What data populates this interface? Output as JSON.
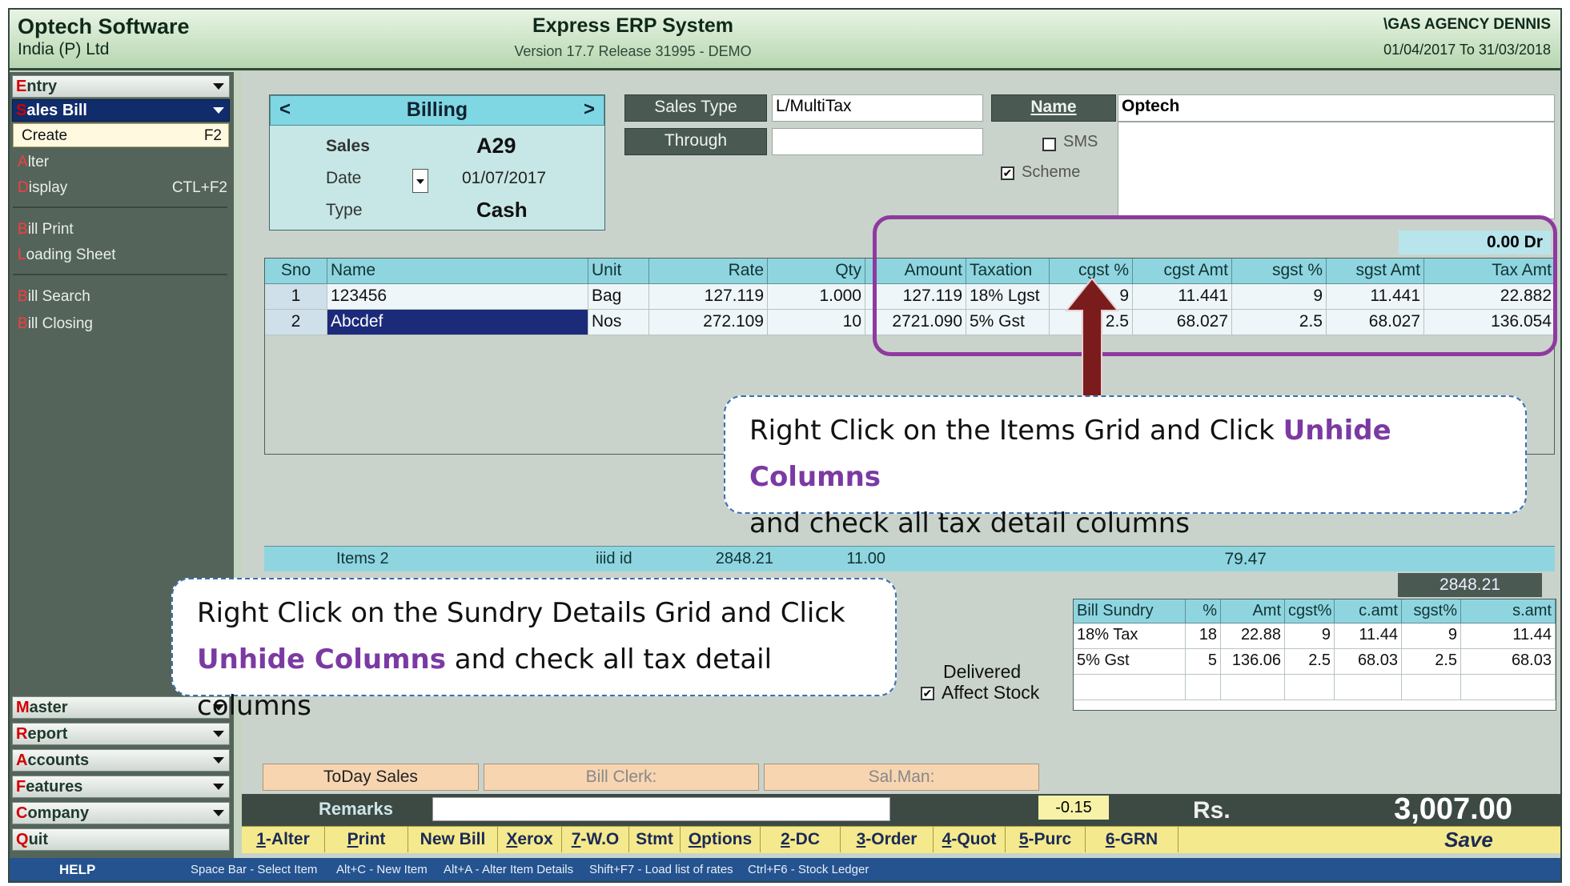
{
  "header": {
    "company_line1": "Optech Software",
    "company_line2": "India (P) Ltd",
    "app_title": "Express ERP System",
    "version": "Version 17.7 Release 31995 - DEMO",
    "agency": "\\GAS AGENCY DENNIS",
    "period": "01/04/2017 To 31/03/2018"
  },
  "sidebar": {
    "entry": {
      "first": "E",
      "rest": "ntry"
    },
    "sales_bill": {
      "first": "S",
      "rest": "ales Bill"
    },
    "create": {
      "first": "C",
      "rest": "reate",
      "shortcut": "F2"
    },
    "alter": {
      "first": "A",
      "rest": "lter"
    },
    "display": {
      "first": "D",
      "rest": "isplay",
      "shortcut": "CTL+F2"
    },
    "bill_print": {
      "first": "B",
      "rest": "ill Print"
    },
    "loading_sheet": {
      "first": "L",
      "rest": "oading Sheet"
    },
    "bill_search": {
      "first": "B",
      "rest": "ill Search"
    },
    "bill_closing": {
      "first": "B",
      "rest": "ill Closing"
    },
    "master": {
      "first": "M",
      "rest": "aster"
    },
    "report": {
      "first": "R",
      "rest": "eport"
    },
    "accounts": {
      "first": "A",
      "rest": "ccounts"
    },
    "features": {
      "first": "F",
      "rest": "eatures"
    },
    "company": {
      "first": "C",
      "rest": "ompany"
    },
    "quit": {
      "first": "Q",
      "rest": "uit"
    }
  },
  "billing": {
    "prev": "<",
    "title": "Billing",
    "next": ">",
    "sales_label": "Sales",
    "sales_value": "A29",
    "date_label": "Date",
    "date_value": "01/07/2017",
    "type_label": "Type",
    "type_value": "Cash"
  },
  "form": {
    "sales_type_label": "Sales Type",
    "sales_type_value": "L/MultiTax",
    "through_label": "Through",
    "through_value": "",
    "name_label": "Name",
    "name_value": "Optech",
    "sms_label": "SMS",
    "sms_checked": false,
    "scheme_label": "Scheme",
    "scheme_checked": true,
    "balance": "0.00 Dr"
  },
  "items_grid": {
    "headers": [
      "Sno",
      "Name",
      "Unit",
      "Rate",
      "Qty",
      "Amount",
      "Taxation",
      "cgst %",
      "cgst Amt",
      "sgst %",
      "sgst Amt",
      "Tax Amt"
    ],
    "rows": [
      [
        "1",
        "123456",
        "Bag",
        "127.119",
        "1.000",
        "127.119",
        "18% Lgst",
        "9",
        "11.441",
        "9",
        "11.441",
        "22.882"
      ],
      [
        "2",
        "Abcdef",
        "Nos",
        "272.109",
        "10",
        "2721.090",
        "5% Gst",
        "2.5",
        "68.027",
        "2.5",
        "68.027",
        "136.054"
      ]
    ],
    "footer": {
      "items": "Items 2",
      "unit": "iiid id",
      "rate": "2848.21",
      "qty": "11.00",
      "cgst_amt": "79.47"
    }
  },
  "sundry": {
    "subtotal": "2848.21",
    "headers": [
      "Bill Sundry",
      "%",
      "Amt",
      "cgst%",
      "c.amt",
      "sgst%",
      "s.amt"
    ],
    "rows": [
      [
        "18% Tax",
        "18",
        "22.88",
        "9",
        "11.44",
        "9",
        "11.44"
      ],
      [
        "5% Gst",
        "5",
        "136.06",
        "2.5",
        "68.03",
        "2.5",
        "68.03"
      ]
    ]
  },
  "options": {
    "delivered_label": "Delivered",
    "affect_stock_label": "Affect Stock",
    "affect_stock_checked": true
  },
  "bottom": {
    "today_sales": "ToDay Sales",
    "bill_clerk": "Bill Clerk:",
    "sal_man": "Sal.Man:",
    "remarks_label": "Remarks",
    "remarks_value": "",
    "round_off": "-0.15",
    "rs_label": "Rs.",
    "total": "3,007.00"
  },
  "fkeys": [
    {
      "u": "1",
      "rest": "-Alter"
    },
    {
      "u": "P",
      "rest": "rint"
    },
    {
      "u": "",
      "rest": "New Bill"
    },
    {
      "u": "X",
      "rest": "erox"
    },
    {
      "u": "7",
      "rest": "-W.O"
    },
    {
      "u": "",
      "rest": "Stmt"
    },
    {
      "u": "O",
      "rest": "ptions"
    },
    {
      "u": "2",
      "rest": "-DC"
    },
    {
      "u": "3",
      "rest": "-Order"
    },
    {
      "u": "4",
      "rest": "-Quot"
    },
    {
      "u": "5",
      "rest": "-Purc"
    },
    {
      "u": "6",
      "rest": "-GRN"
    }
  ],
  "save_label": "Save",
  "help": {
    "label": "HELP",
    "hints": [
      "Space Bar - Select Item",
      "Alt+C - New Item",
      "Alt+A - Alter Item Details",
      "Shift+F7 - Load list of rates",
      "Ctrl+F6 - Stock Ledger"
    ]
  },
  "callouts": {
    "items_part1": "Right Click on the Items Grid and Click ",
    "items_highlight": "Unhide Columns",
    "items_part2": "and check all tax detail columns",
    "sundry_part1": "Right Click on the Sundry Details Grid and Click",
    "sundry_highlight": "Unhide Columns",
    "sundry_part2": " and check all tax detail columns"
  },
  "colors": {
    "highlight_border": "#8e3a9e",
    "arrow": "#7a1c1c",
    "callout_border": "#3b6fb3",
    "accent_text": "#7b3aa3"
  }
}
